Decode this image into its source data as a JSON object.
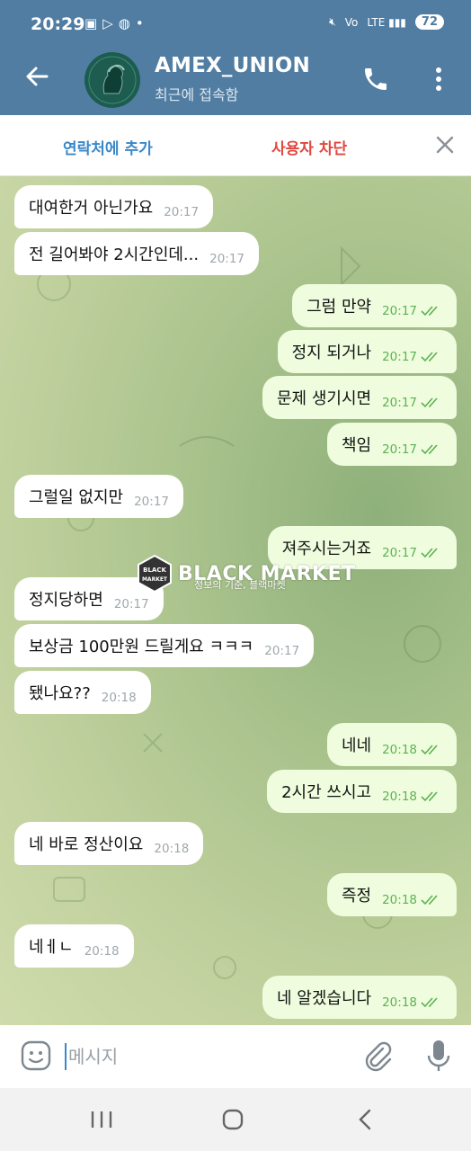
{
  "status_bar": {
    "time": "20:29",
    "battery": "72",
    "left_icons": [
      "screenshot-icon",
      "play-icon",
      "basketball-icon",
      "dot-icon"
    ],
    "right_icons": [
      "mute-icon",
      "wifi-calling-icon",
      "lte-signal-icon",
      "battery-icon"
    ]
  },
  "header": {
    "title": "AMEX_UNION",
    "subtitle": "최근에 접속함"
  },
  "action_bar": {
    "add_contact": "연락처에 추가",
    "block_user": "사용자 차단"
  },
  "messages": [
    {
      "side": "in",
      "text": "대여한거 아닌가요",
      "time": "20:17"
    },
    {
      "side": "in",
      "text": "전 길어봐야 2시간인데...",
      "time": "20:17"
    },
    {
      "side": "out",
      "text": "그럼 만약",
      "time": "20:17"
    },
    {
      "side": "out",
      "text": "정지 되거나",
      "time": "20:17"
    },
    {
      "side": "out",
      "text": "문제 생기시면",
      "time": "20:17"
    },
    {
      "side": "out",
      "text": "책임",
      "time": "20:17"
    },
    {
      "side": "in",
      "text": "그럴일 없지만",
      "time": "20:17"
    },
    {
      "side": "out",
      "text": "져주시는거죠",
      "time": "20:17"
    },
    {
      "side": "in",
      "text": "정지당하면",
      "time": "20:17"
    },
    {
      "side": "in",
      "text": "보상금 100만원 드릴게요 ㅋㅋㅋ",
      "time": "20:17"
    },
    {
      "side": "in",
      "text": "됐나요??",
      "time": "20:18"
    },
    {
      "side": "out",
      "text": "네네",
      "time": "20:18"
    },
    {
      "side": "out",
      "text": "2시간 쓰시고",
      "time": "20:18"
    },
    {
      "side": "in",
      "text": "네 바로 정산이요",
      "time": "20:18"
    },
    {
      "side": "out",
      "text": "즉정",
      "time": "20:18"
    },
    {
      "side": "in",
      "text": "네ㅔㄴ",
      "time": "20:18"
    },
    {
      "side": "out",
      "text": "네 알겠습니다",
      "time": "20:18"
    }
  ],
  "watermark": {
    "badge_text": "BLACK MARKET",
    "title": "BLACK MARKET",
    "subtitle": "정보의 기준, 블랙마켓"
  },
  "composer": {
    "placeholder": "메시지"
  },
  "colors": {
    "header": "#517da2",
    "incoming_bubble": "#ffffff",
    "outgoing_bubble": "#effdde",
    "outgoing_time": "#5db152",
    "add_contact": "#3a88c8",
    "block_user": "#e0473f"
  }
}
